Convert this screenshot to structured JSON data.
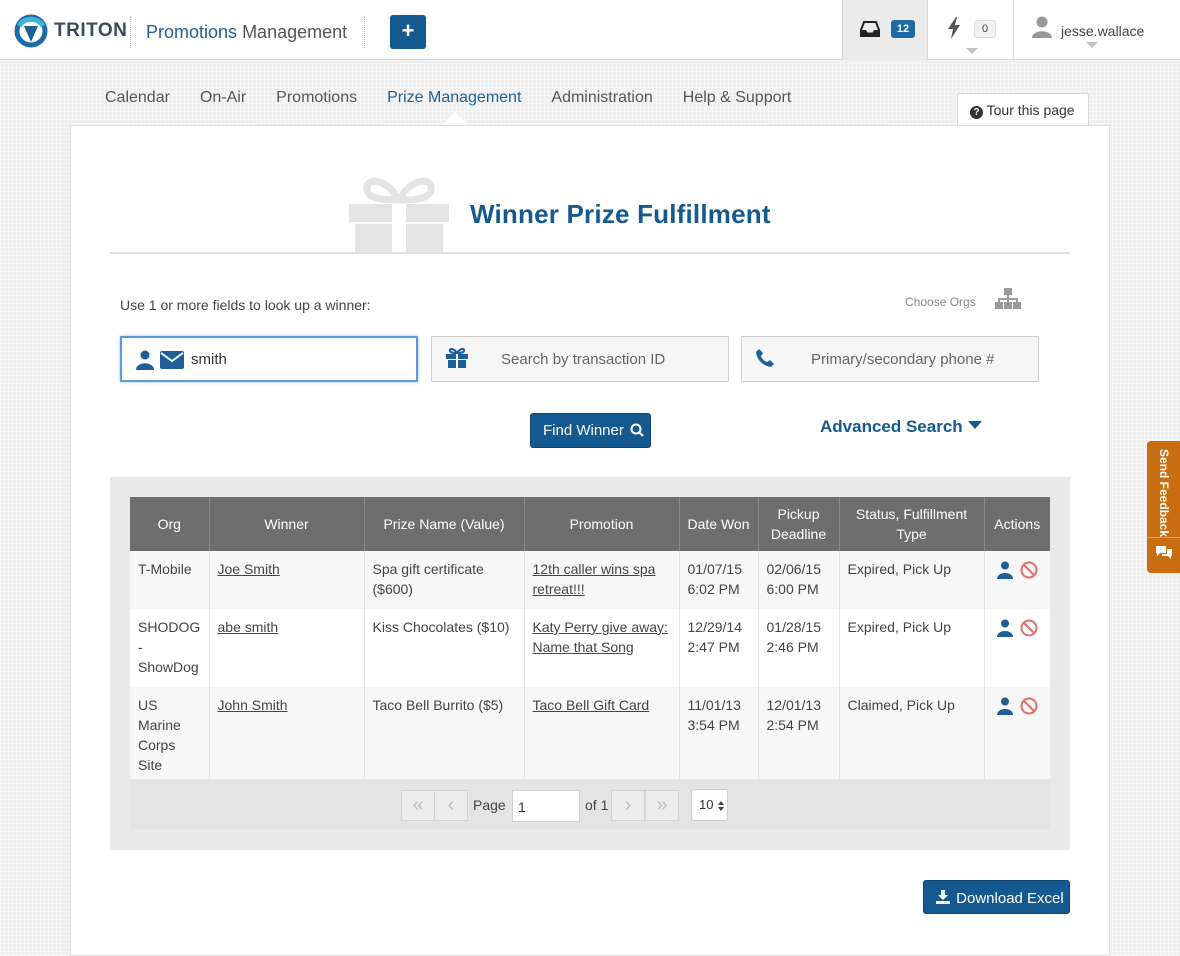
{
  "header": {
    "logo_text": "TRITON",
    "app_title_accent": "Promotions",
    "app_title_rest": "Management",
    "add_label": "+",
    "inbox_count": "12",
    "alert_count": "0",
    "username": "jesse.wallace"
  },
  "nav": {
    "items": [
      "Calendar",
      "On-Air",
      "Promotions",
      "Prize Management",
      "Administration",
      "Help & Support"
    ],
    "active": "Prize Management",
    "tour_label": "Tour this page"
  },
  "page": {
    "title": "Winner Prize Fulfillment",
    "lookup_label": "Use 1 or more fields to look up a winner:",
    "choose_orgs": "Choose Orgs"
  },
  "search": {
    "winner_value": "smith",
    "transaction_placeholder": "Search by transaction ID",
    "phone_placeholder": "Primary/secondary phone #",
    "find_label": "Find Winner",
    "advanced_label": "Advanced Search"
  },
  "table": {
    "columns": [
      "Org",
      "Winner",
      "Prize Name (Value)",
      "Promotion",
      "Date Won",
      "Pickup Deadline",
      "Status, Fulfillment Type",
      "Actions"
    ],
    "rows": [
      {
        "org": "T-Mobile",
        "winner": "Joe Smith",
        "prize": "Spa gift certificate ($600)",
        "promotion": "12th caller wins spa retreat!!!",
        "date_won": "01/07/15 6:02 PM",
        "deadline": "02/06/15 6:00 PM",
        "status": "Expired, Pick Up"
      },
      {
        "org": "SHODOG - ShowDog",
        "winner": "abe smith",
        "prize": "Kiss Chocolates ($10)",
        "promotion": "Katy Perry give away: Name that Song",
        "date_won": "12/29/14 2:47 PM",
        "deadline": "01/28/15 2:46 PM",
        "status": "Expired, Pick Up"
      },
      {
        "org": "US Marine Corps Site",
        "winner": "John Smith",
        "prize": "Taco Bell Burrito ($5)",
        "promotion": "Taco Bell Gift Card",
        "date_won": "11/01/13 3:54 PM",
        "deadline": "12/01/13 2:54 PM",
        "status": "Claimed, Pick Up"
      }
    ]
  },
  "pager": {
    "page_label": "Page",
    "page_value": "1",
    "of_label": "of 1",
    "page_size": "10",
    "first": "«",
    "prev": "‹",
    "next": "›",
    "last": "»"
  },
  "download_label": "Download Excel",
  "feedback_label": "Send Feedback",
  "colors": {
    "brand_blue": "#14598f",
    "feedback_orange": "#c96d12",
    "remove_red": "#e07070"
  }
}
